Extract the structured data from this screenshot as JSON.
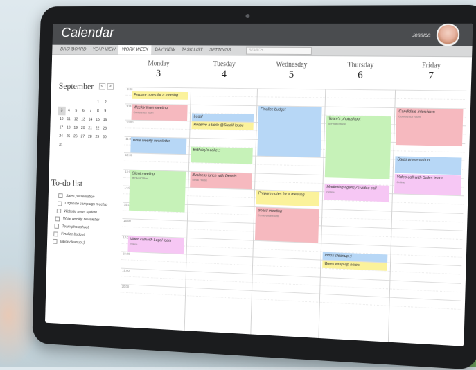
{
  "app": {
    "title": "Calendar",
    "user_name": "Jessica"
  },
  "nav": {
    "items": [
      {
        "label": "DASHBOARD",
        "active": false
      },
      {
        "label": "YEAR VIEW",
        "active": false
      },
      {
        "label": "WORK WEEK",
        "active": true
      },
      {
        "label": "DAY VIEW",
        "active": false
      },
      {
        "label": "TASK LIST",
        "active": false
      },
      {
        "label": "SETTINGS",
        "active": false
      }
    ],
    "search_placeholder": "SEARCH..."
  },
  "mini_calendar": {
    "month": "September",
    "prev": "<",
    "next": ">",
    "weeks": [
      [
        "",
        "",
        "",
        "",
        "",
        "1",
        "2"
      ],
      [
        "3",
        "4",
        "5",
        "6",
        "7",
        "8",
        "9"
      ],
      [
        "10",
        "11",
        "12",
        "13",
        "14",
        "15",
        "16"
      ],
      [
        "17",
        "18",
        "19",
        "20",
        "21",
        "22",
        "23"
      ],
      [
        "24",
        "25",
        "26",
        "27",
        "28",
        "29",
        "30"
      ],
      [
        "31",
        "",
        "",
        "",
        "",
        "",
        ""
      ]
    ],
    "selected": "3"
  },
  "todo": {
    "title": "To-do list",
    "items": [
      "Sales presentation",
      "Organize campaign meetup",
      "Website news update",
      "Write weekly newsletter",
      "Team photoshoot",
      "Finalize budget",
      "Inbox cleanup :)"
    ]
  },
  "days": [
    {
      "name": "Monday",
      "date": "3"
    },
    {
      "name": "Tuesday",
      "date": "4"
    },
    {
      "name": "Wednesday",
      "date": "5"
    },
    {
      "name": "Thursday",
      "date": "6"
    },
    {
      "name": "Friday",
      "date": "7"
    }
  ],
  "time_labels": [
    "8:00",
    "9:00",
    "10:00",
    "11:00",
    "12:00",
    "13:00",
    "14:00",
    "15:00",
    "16:00",
    "17:00",
    "18:00",
    "19:00",
    "20:00"
  ],
  "events": [
    {
      "day": 0,
      "start": 8.25,
      "end": 8.75,
      "title": "Prepare notes for a meeting",
      "sub": "",
      "color": "yellow"
    },
    {
      "day": 0,
      "start": 9.0,
      "end": 10.0,
      "title": "Weekly team meeting",
      "sub": "Conference room",
      "color": "pink"
    },
    {
      "day": 0,
      "start": 11.0,
      "end": 12.0,
      "title": "Write weekly newsletter",
      "sub": "",
      "color": "blue"
    },
    {
      "day": 0,
      "start": 13.0,
      "end": 15.5,
      "title": "Client meeting",
      "sub": "@ClientOffice",
      "color": "green"
    },
    {
      "day": 0,
      "start": 17.0,
      "end": 18.0,
      "title": "Video call with Legal team",
      "sub": "Online",
      "color": "purple"
    },
    {
      "day": 1,
      "start": 9.5,
      "end": 10.0,
      "title": "Legal",
      "sub": "",
      "color": "blue"
    },
    {
      "day": 1,
      "start": 10.0,
      "end": 10.5,
      "title": "Reserve a table @SteakHouse",
      "sub": "",
      "color": "yellow"
    },
    {
      "day": 1,
      "start": 11.5,
      "end": 12.5,
      "title": "Birthday's cake :)",
      "sub": "",
      "color": "green"
    },
    {
      "day": 1,
      "start": 13.0,
      "end": 14.0,
      "title": "Business lunch with Dennis",
      "sub": "Steak House",
      "color": "pink"
    },
    {
      "day": 2,
      "start": 9.0,
      "end": 12.0,
      "title": "Finalize budget",
      "sub": "",
      "color": "blue"
    },
    {
      "day": 2,
      "start": 14.0,
      "end": 14.9,
      "title": "Prepare notes for a meeting",
      "sub": "",
      "color": "yellow"
    },
    {
      "day": 2,
      "start": 15.0,
      "end": 17.0,
      "title": "Board meeting",
      "sub": "Conference room",
      "color": "pink"
    },
    {
      "day": 3,
      "start": 9.5,
      "end": 13.2,
      "title": "Team's photoshoot",
      "sub": "@PhotoStudio",
      "color": "green"
    },
    {
      "day": 3,
      "start": 13.5,
      "end": 14.5,
      "title": "Marketing agency's video call",
      "sub": "Online",
      "color": "purple"
    },
    {
      "day": 4,
      "start": 9.0,
      "end": 11.2,
      "title": "Candidate interviews",
      "sub": "Conference room",
      "color": "pink"
    },
    {
      "day": 4,
      "start": 11.8,
      "end": 12.8,
      "title": "Sales presentation",
      "sub": "",
      "color": "blue"
    },
    {
      "day": 4,
      "start": 12.8,
      "end": 14.0,
      "title": "Video call with Sales team",
      "sub": "Online",
      "color": "purple"
    },
    {
      "day": 3,
      "start": 17.5,
      "end": 18.0,
      "title": "Inbox cleanup :)",
      "sub": "",
      "color": "blue"
    },
    {
      "day": 3,
      "start": 18.0,
      "end": 18.5,
      "title": "Week wrap-up notes",
      "sub": "",
      "color": "yellow"
    }
  ]
}
